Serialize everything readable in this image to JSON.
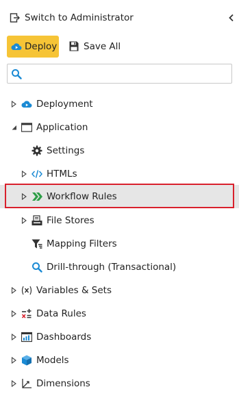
{
  "header": {
    "switch_label": "Switch to Administrator",
    "switch_icon": "switch-user-icon",
    "collapse_icon": "chevron-left-icon"
  },
  "toolbar": {
    "deploy_label": "Deploy",
    "deploy_icon": "cloud-upload-icon",
    "save_all_label": "Save All",
    "save_icon": "floppy-disk-icon",
    "deploy_color": "#f6c436"
  },
  "search": {
    "placeholder": "",
    "value": "",
    "icon": "search-icon"
  },
  "tree": {
    "items": [
      {
        "label": "Deployment",
        "icon": "deployment-cloud-icon",
        "expander": "collapsed"
      },
      {
        "label": "Application",
        "icon": "window-icon",
        "expander": "expanded"
      },
      {
        "label": "Settings",
        "icon": "gear-icon",
        "expander": "none"
      },
      {
        "label": "HTMLs",
        "icon": "code-icon",
        "expander": "collapsed"
      },
      {
        "label": "Workflow Rules",
        "icon": "workflow-chevrons-icon",
        "expander": "collapsed",
        "selected": true
      },
      {
        "label": "File Stores",
        "icon": "file-store-icon",
        "expander": "collapsed"
      },
      {
        "label": "Mapping Filters",
        "icon": "filter-icon",
        "expander": "none"
      },
      {
        "label": "Drill-through (Transactional)",
        "icon": "magnifier-icon",
        "expander": "none"
      },
      {
        "label": "Variables & Sets",
        "icon": "variable-x-icon",
        "expander": "collapsed"
      },
      {
        "label": "Data Rules",
        "icon": "data-rules-icon",
        "expander": "collapsed"
      },
      {
        "label": "Dashboards",
        "icon": "dashboard-icon",
        "expander": "collapsed"
      },
      {
        "label": "Models",
        "icon": "cube-icon",
        "expander": "collapsed"
      },
      {
        "label": "Dimensions",
        "icon": "axis-icon",
        "expander": "collapsed"
      }
    ]
  },
  "colors": {
    "accent_blue": "#1a8ad4",
    "workflow_green": "#2e9e47",
    "selection_bg": "#e6e6e6",
    "highlight_border": "#d9202c"
  }
}
